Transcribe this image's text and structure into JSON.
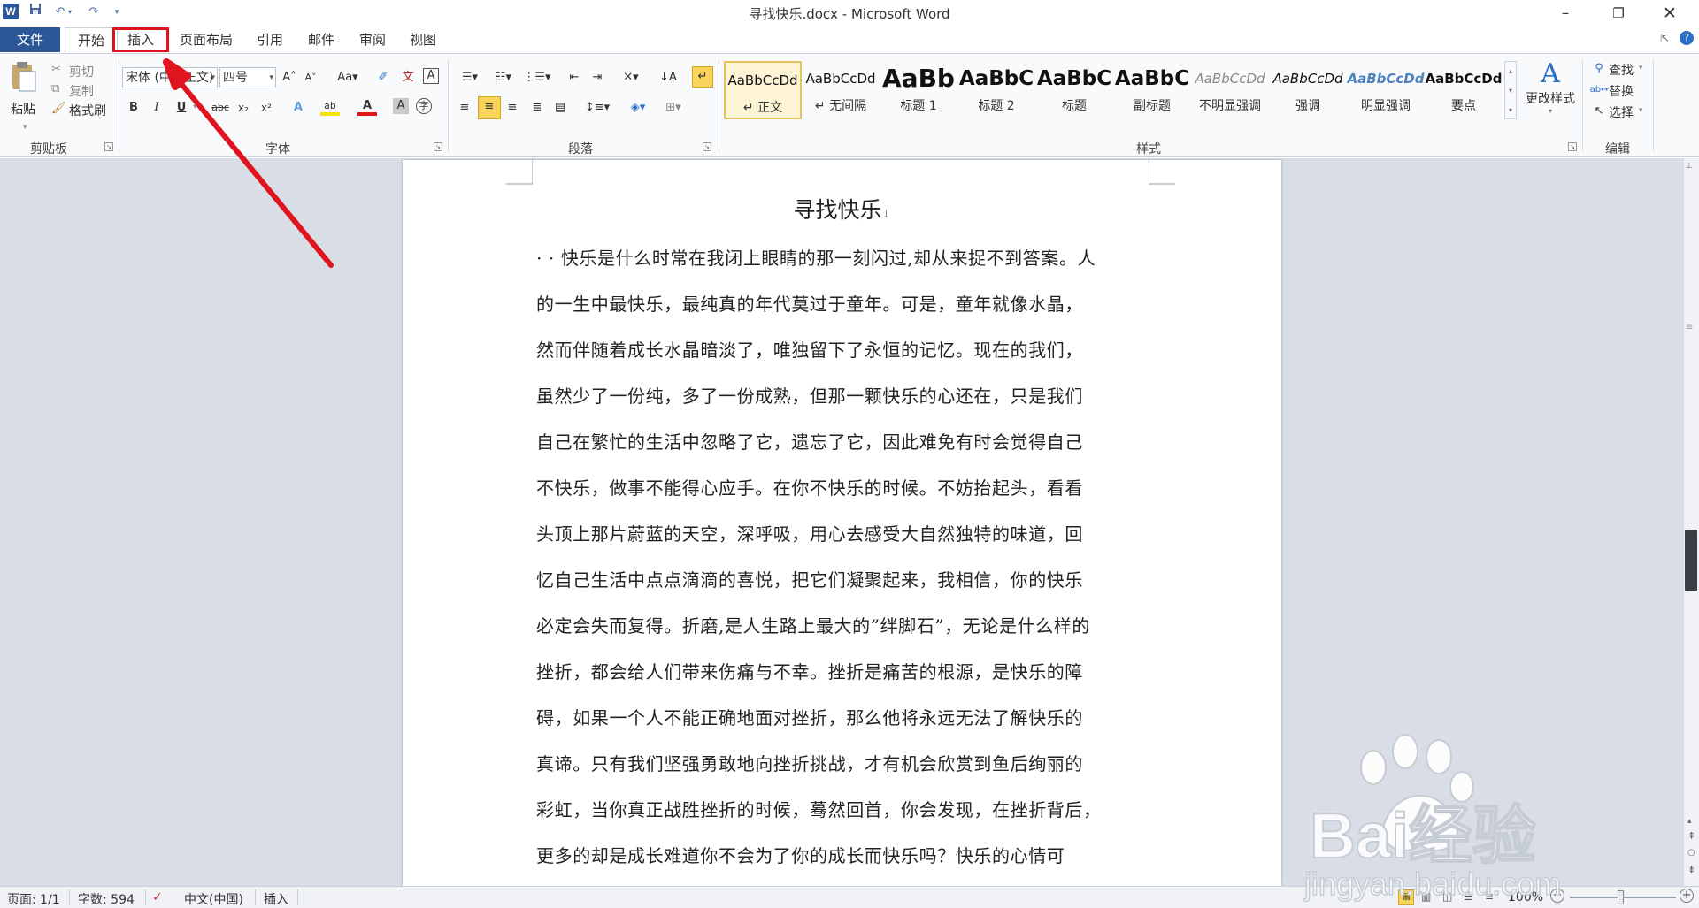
{
  "window": {
    "title": "寻找快乐.docx - Microsoft Word",
    "app_icon": "W"
  },
  "quick_access": {
    "save": "save-icon",
    "undo": "undo-icon",
    "redo": "redo-icon",
    "customize": "dropdown-icon"
  },
  "tabs": {
    "file": "文件",
    "home": "开始",
    "insert": "插入",
    "layout": "页面布局",
    "references": "引用",
    "mailings": "邮件",
    "review": "审阅",
    "view": "视图"
  },
  "clipboard": {
    "paste": "粘贴",
    "cut": "剪切",
    "copy": "复制",
    "format_painter": "格式刷",
    "label": "剪贴板"
  },
  "font": {
    "font_name": "宋体 (中文正文)",
    "font_size": "四号",
    "label": "字体",
    "bold": "B",
    "italic": "I",
    "underline": "U",
    "strike": "abc",
    "subscript": "x₂",
    "superscript": "x²",
    "change_case": "Aa"
  },
  "paragraph": {
    "label": "段落"
  },
  "styles": {
    "label": "样式",
    "items": [
      {
        "preview": "AaBbCcDd",
        "name": "↵ 正文"
      },
      {
        "preview": "AaBbCcDd",
        "name": "↵ 无间隔"
      },
      {
        "preview": "AaBb",
        "name": "标题 1"
      },
      {
        "preview": "AaBbC",
        "name": "标题 2"
      },
      {
        "preview": "AaBbC",
        "name": "标题"
      },
      {
        "preview": "AaBbC",
        "name": "副标题"
      },
      {
        "preview": "AaBbCcDd",
        "name": "不明显强调"
      },
      {
        "preview": "AaBbCcDd",
        "name": "强调"
      },
      {
        "preview": "AaBbCcDd",
        "name": "明显强调"
      },
      {
        "preview": "AaBbCcDd",
        "name": "要点"
      }
    ],
    "change_styles": "更改样式"
  },
  "editing": {
    "find": "查找",
    "replace": "替换",
    "select": "选择",
    "label": "编辑"
  },
  "document": {
    "title": "寻找快乐",
    "lines": [
      "· · 快乐是什么时常在我闭上眼睛的那一刻闪过,却从来捉不到答案。人",
      "的一生中最快乐，最纯真的年代莫过于童年。可是，童年就像水晶，",
      "然而伴随着成长水晶暗淡了，唯独留下了永恒的记忆。现在的我们，",
      "虽然少了一份纯，多了一份成熟，但那一颗快乐的心还在，只是我们",
      "自己在繁忙的生活中忽略了它，遗忘了它，因此难免有时会觉得自己",
      "不快乐，做事不能得心应手。在你不快乐的时候。不妨抬起头，看看",
      "头顶上那片蔚蓝的天空，深呼吸，用心去感受大自然独特的味道，回",
      "忆自己生活中点点滴滴的喜悦，把它们凝聚起来，我相信，你的快乐",
      "必定会失而复得。折磨,是人生路上最大的”绊脚石”，无论是什么样的",
      "挫折，都会给人们带来伤痛与不幸。挫折是痛苦的根源，是快乐的障",
      "碍，如果一个人不能正确地面对挫折，那么他将永远无法了解快乐的",
      "真谛。只有我们坚强勇敢地向挫折挑战，才有机会欣赏到鱼后绚丽的",
      "彩虹，当你真正战胜挫折的时候，蓦然回首，你会发现，在挫折背后，",
      " 更多的却是成长难道你不会为了你的成长而快乐吗？快乐的心情可"
    ]
  },
  "status": {
    "page": "页面: 1/1",
    "words": "字数: 594",
    "language": "中文(中国)",
    "mode": "插入",
    "zoom": "100%"
  },
  "watermark": {
    "brand": "Bai经验",
    "url": "jingyan.baidu.com"
  },
  "colors": {
    "file_tab": "#2b5797",
    "highlight_box": "#e0141e",
    "arrow": "#e0141e"
  }
}
